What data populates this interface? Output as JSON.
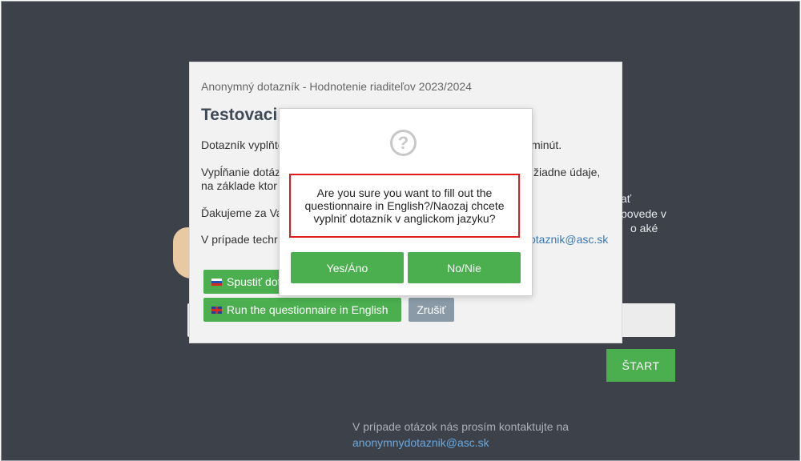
{
  "background": {
    "right_fragments": [
      "ať",
      "povede v",
      "o aké"
    ],
    "start_label": "ŠTART",
    "footer_text": "V prípade otázok nás prosím kontaktujte na",
    "footer_email": "anonymnydotaznik@asc.sk"
  },
  "modal": {
    "subtitle": "Anonymný dotazník - Hodnotenie riaditeľov 2023/2024",
    "heading": "Testovaci",
    "p1_left": "Dotazník vyplňte",
    "p1_right": "minút.",
    "p2_left1": "Vypĺňanie dotáz",
    "p2_right1": "žiadne údaje,",
    "p2_left2": "na základe ktor",
    "p3_left": "Ďakujeme za Va",
    "p4_left": "V prípade techr",
    "p4_link": "otaznik@asc.sk",
    "start_sk_label": "Spustiť dot",
    "start_en_label": "Run the questionnaire in English",
    "cancel_label": "Zrušiť"
  },
  "confirm": {
    "icon": "question-circle-icon",
    "message": "Are you sure you want to fill out the questionnaire in English?/Naozaj chcete vyplniť dotazník v anglickom jazyku?",
    "yes_label": "Yes/Áno",
    "no_label": "No/Nie"
  }
}
